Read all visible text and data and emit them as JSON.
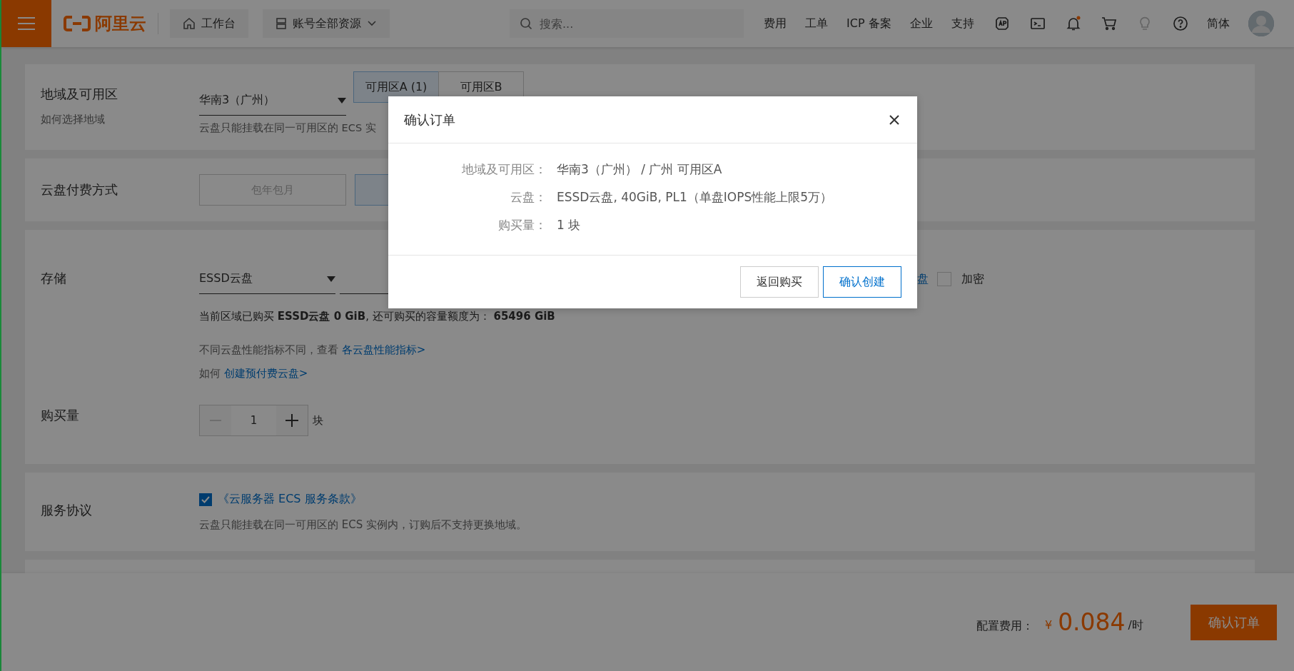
{
  "topbar": {
    "logo_text": "阿里云",
    "workbench": "工作台",
    "resource_menu": "账号全部资源",
    "search": {
      "placeholder": "搜索..."
    },
    "nav_links": [
      "费用",
      "工单",
      "ICP 备案",
      "企业",
      "支持"
    ],
    "language": "简体"
  },
  "region": {
    "label": "地域及可用区",
    "help_link": "如何选择地域",
    "select": "华南3（广州）",
    "zones": [
      {
        "label": "可用区A (1)",
        "selected": true
      },
      {
        "label": "可用区B",
        "selected": false
      }
    ],
    "note": "云盘只能挂载在同一可用区的 ECS 实"
  },
  "billing": {
    "label": "云盘付费方式",
    "options": [
      {
        "label": "包年包月",
        "selected": false
      },
      {
        "selected": true
      }
    ]
  },
  "storage": {
    "label": "存储",
    "select": "ESSD云盘",
    "option_fragment": "盘",
    "encrypt": {
      "label": "加密",
      "checked": false
    },
    "quota_note": "当前区域已购买 **ESSD云盘 0 GiB**, 还可购买的容量额度为： **65496 GiB**",
    "perf_note": {
      "text": "不同云盘性能指标不同，查看 ",
      "link": "各云盘性能指标>"
    },
    "prepaid_note": {
      "text": "如何 ",
      "link": "创建预付费云盘>"
    }
  },
  "quantity": {
    "label": "购买量",
    "value": "1",
    "unit": "块"
  },
  "agreement": {
    "label": "服务协议",
    "checked": true,
    "link": "《云服务器 ECS 服务条款》",
    "note": "云盘只能挂载在同一可用区的 ECS 实例内，订购后不支持更换地域。"
  },
  "footer": {
    "price_label": "配置费用：",
    "currency": "¥",
    "price": "0.084",
    "unit": "/时",
    "confirm_button": "确认订单"
  },
  "dialog": {
    "title": "确认订单",
    "rows": [
      {
        "label": "地域及可用区：",
        "value": "华南3（广州） / 广州 可用区A"
      },
      {
        "label": "云盘：",
        "value": "ESSD云盘, 40GiB, PL1（单盘IOPS性能上限5万）"
      },
      {
        "label": "购买量：",
        "value": "1 块"
      }
    ],
    "buttons": [
      {
        "label": "返回购买",
        "kind": "secondary"
      },
      {
        "label": "确认创建",
        "kind": "primary"
      }
    ]
  }
}
